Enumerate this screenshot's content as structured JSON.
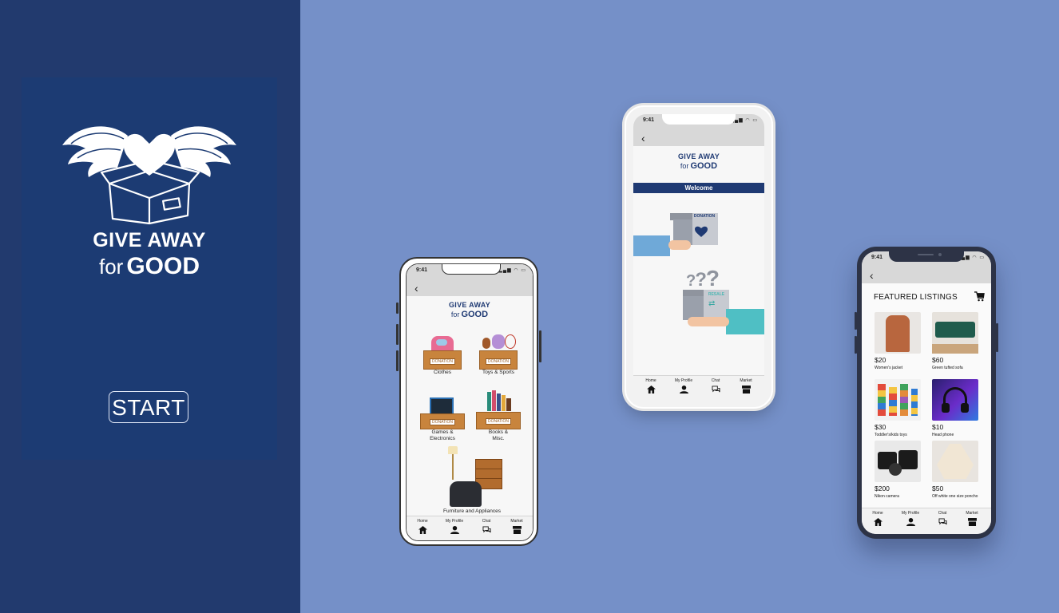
{
  "splash": {
    "brand_line1": "GIVE AWAY",
    "brand_for": "for",
    "brand_good": "GOOD",
    "start_label": "START"
  },
  "colors": {
    "left_bg": "#223a6e",
    "splash_bg": "#1c3b73",
    "right_bg": "#7590c8",
    "brand_navy": "#1f3a73",
    "box_brown": "#c8843d"
  },
  "status": {
    "time": "9:41"
  },
  "app_brand": {
    "line1": "GIVE AWAY",
    "for": "for",
    "good": "GOOD"
  },
  "tabs": [
    {
      "label": "Home",
      "icon": "home-icon"
    },
    {
      "label": "My Profile",
      "icon": "profile-icon"
    },
    {
      "label": "Chat",
      "icon": "chat-icon"
    },
    {
      "label": "Market",
      "icon": "market-icon"
    }
  ],
  "categories_screen": {
    "items": [
      {
        "label": "Clothes",
        "tag": "DONATION"
      },
      {
        "label": "Toys & Sports",
        "tag": "DONATION"
      },
      {
        "label": "Games &",
        "label2": "Electronics",
        "tag": "DONATION"
      },
      {
        "label": "Books &",
        "label2": "Misc.",
        "tag": "DONATION"
      },
      {
        "label": "Furniture and Appliances"
      }
    ]
  },
  "welcome_screen": {
    "banner": "Welcome",
    "donation_label": "DONATION",
    "resale_label": "RESALE"
  },
  "listings_screen": {
    "title": "FEATURED LISTINGS",
    "items": [
      {
        "price": "$20",
        "name": "Women's jacket"
      },
      {
        "price": "$60",
        "name": "Green tufted sofa"
      },
      {
        "price": "$30",
        "name": "Toddler's/kids toys"
      },
      {
        "price": "$10",
        "name": "Head phone"
      },
      {
        "price": "$200",
        "name": "Nikon camera"
      },
      {
        "price": "$50",
        "name": "Off white one size poncho"
      }
    ]
  }
}
